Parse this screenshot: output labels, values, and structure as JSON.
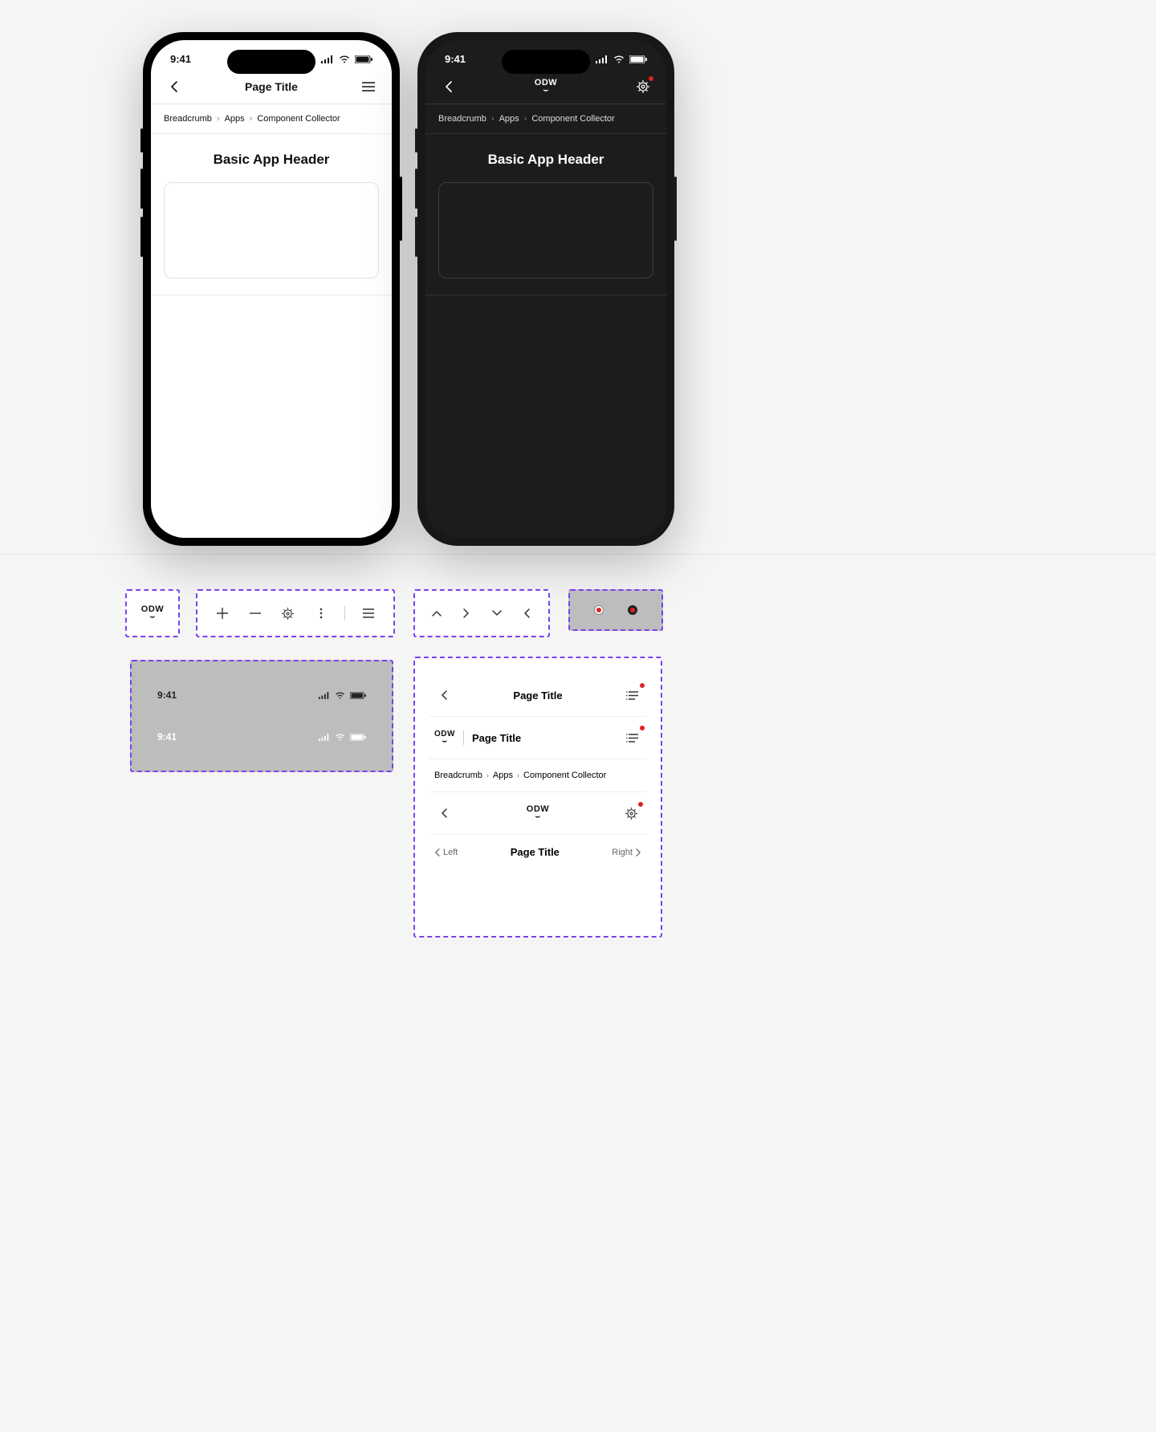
{
  "status_time": "9:41",
  "page_title": "Page Title",
  "breadcrumbs": [
    "Breadcrumb",
    "Apps",
    "Component Collector"
  ],
  "section_heading": "Basic App Header",
  "logo_text": "ODW",
  "variants": {
    "v1_title": "Page Title",
    "v2_title": "Page Title",
    "v3_crumbs": [
      "Breadcrumb",
      "Apps",
      "Component Collector"
    ],
    "v5_left": "Left",
    "v5_title": "Page Title",
    "v5_right": "Right"
  }
}
